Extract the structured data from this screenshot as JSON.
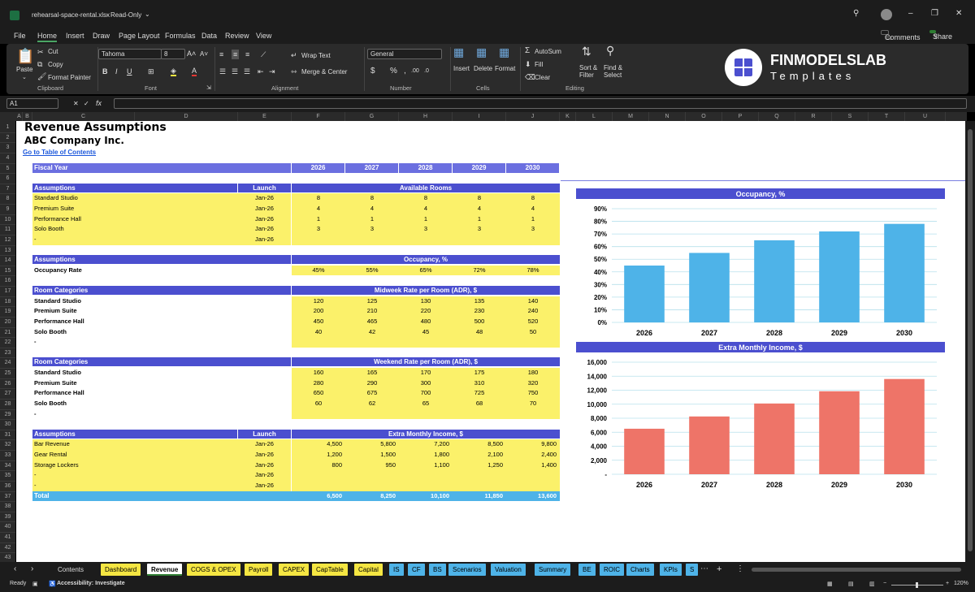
{
  "window": {
    "title": "rehearsal-space-rental.xlsx",
    "mode": "Read-Only"
  },
  "menu": [
    "File",
    "Home",
    "Insert",
    "Draw",
    "Page Layout",
    "Formulas",
    "Data",
    "Review",
    "View"
  ],
  "actions": {
    "comments": "Comments",
    "share": "Share"
  },
  "ribbon": {
    "clipboard": {
      "paste": "Paste",
      "cut": "Cut",
      "copy": "Copy",
      "format_painter": "Format Painter",
      "label": "Clipboard"
    },
    "font": {
      "name": "Tahoma",
      "size": "8",
      "label": "Font"
    },
    "alignment": {
      "wrap": "Wrap Text",
      "merge": "Merge & Center",
      "label": "Alignment"
    },
    "number": {
      "format": "General",
      "label": "Number"
    },
    "cells": {
      "insert": "Insert",
      "delete": "Delete",
      "format": "Format",
      "label": "Cells"
    },
    "editing": {
      "autosum": "AutoSum",
      "fill": "Fill",
      "clear": "Clear",
      "sort": "Sort &",
      "filter": "Filter",
      "find": "Find &",
      "select": "Select",
      "label": "Editing"
    },
    "brand": {
      "name": "FINMODELSLAB",
      "sub": "Templates"
    }
  },
  "formula_bar": {
    "cell_ref": "A1",
    "fx": "fx",
    "value": ""
  },
  "columns": [
    "A",
    "B",
    "C",
    "D",
    "E",
    "F",
    "G",
    "H",
    "I",
    "J",
    "K",
    "L",
    "M",
    "N",
    "O",
    "P",
    "Q",
    "R",
    "S",
    "T",
    "U"
  ],
  "rows": [
    "1",
    "2",
    "3",
    "4",
    "5",
    "6",
    "7",
    "8",
    "9",
    "10",
    "11",
    "12",
    "13",
    "14",
    "15",
    "16",
    "17",
    "18",
    "19",
    "20",
    "21",
    "22",
    "23",
    "24",
    "25",
    "26",
    "27",
    "28",
    "29",
    "30",
    "31",
    "32",
    "33",
    "34",
    "35",
    "36",
    "37",
    "38",
    "39",
    "40",
    "41",
    "42",
    "43"
  ],
  "sheet": {
    "title": "Revenue Assumptions",
    "company": "ABC Company Inc.",
    "toc_link": "Go to Table of Contents",
    "fiscal_year_label": "Fiscal Year",
    "years": [
      "2026",
      "2027",
      "2028",
      "2029",
      "2030"
    ],
    "rooms": {
      "header_left": "Assumptions",
      "header_launch": "Launch",
      "header_right": "Available Rooms",
      "rows": [
        {
          "name": "Standard Studio",
          "launch": "Jan-26",
          "values": [
            "8",
            "8",
            "8",
            "8",
            "8"
          ]
        },
        {
          "name": "Premium Suite",
          "launch": "Jan-26",
          "values": [
            "4",
            "4",
            "4",
            "4",
            "4"
          ]
        },
        {
          "name": "Performance Hall",
          "launch": "Jan-26",
          "values": [
            "1",
            "1",
            "1",
            "1",
            "1"
          ]
        },
        {
          "name": "Solo Booth",
          "launch": "Jan-26",
          "values": [
            "3",
            "3",
            "3",
            "3",
            "3"
          ]
        },
        {
          "name": "-",
          "launch": "Jan-26",
          "values": [
            "",
            "",
            "",
            "",
            ""
          ]
        }
      ]
    },
    "occupancy": {
      "header_left": "Assumptions",
      "header_right": "Occupancy, %",
      "row_label": "Occupancy Rate",
      "values": [
        "45%",
        "55%",
        "65%",
        "72%",
        "78%"
      ]
    },
    "midweek": {
      "header_left": "Room Categories",
      "header_right": "Midweek Rate per Room (ADR), $",
      "rows": [
        {
          "name": "Standard Studio",
          "values": [
            "120",
            "125",
            "130",
            "135",
            "140"
          ]
        },
        {
          "name": "Premium Suite",
          "values": [
            "200",
            "210",
            "220",
            "230",
            "240"
          ]
        },
        {
          "name": "Performance Hall",
          "values": [
            "450",
            "465",
            "480",
            "500",
            "520"
          ]
        },
        {
          "name": "Solo Booth",
          "values": [
            "40",
            "42",
            "45",
            "48",
            "50"
          ]
        },
        {
          "name": "-",
          "values": [
            "",
            "",
            "",
            "",
            ""
          ]
        }
      ]
    },
    "weekend": {
      "header_left": "Room Categories",
      "header_right": "Weekend Rate per Room (ADR), $",
      "rows": [
        {
          "name": "Standard Studio",
          "values": [
            "160",
            "165",
            "170",
            "175",
            "180"
          ]
        },
        {
          "name": "Premium Suite",
          "values": [
            "280",
            "290",
            "300",
            "310",
            "320"
          ]
        },
        {
          "name": "Performance Hall",
          "values": [
            "650",
            "675",
            "700",
            "725",
            "750"
          ]
        },
        {
          "name": "Solo Booth",
          "values": [
            "60",
            "62",
            "65",
            "68",
            "70"
          ]
        },
        {
          "name": "-",
          "values": [
            "",
            "",
            "",
            "",
            ""
          ]
        }
      ]
    },
    "extra": {
      "header_left": "Assumptions",
      "header_launch": "Launch",
      "header_right": "Extra Monthly Income, $",
      "rows": [
        {
          "name": "Bar Revenue",
          "launch": "Jan-26",
          "values": [
            "4,500",
            "5,800",
            "7,200",
            "8,500",
            "9,800"
          ]
        },
        {
          "name": "Gear Rental",
          "launch": "Jan-26",
          "values": [
            "1,200",
            "1,500",
            "1,800",
            "2,100",
            "2,400"
          ]
        },
        {
          "name": "Storage Lockers",
          "launch": "Jan-26",
          "values": [
            "800",
            "950",
            "1,100",
            "1,250",
            "1,400"
          ]
        },
        {
          "name": "-",
          "launch": "Jan-26",
          "values": [
            "",
            "",
            "",
            "",
            ""
          ]
        },
        {
          "name": "-",
          "launch": "Jan-26",
          "values": [
            "",
            "",
            "",
            "",
            ""
          ]
        }
      ],
      "total_label": "Total",
      "totals": [
        "6,500",
        "8,250",
        "10,100",
        "11,850",
        "13,600"
      ]
    }
  },
  "chart_data": [
    {
      "type": "bar",
      "title": "Occupancy, %",
      "categories": [
        "2026",
        "2027",
        "2028",
        "2029",
        "2030"
      ],
      "values": [
        45,
        55,
        65,
        72,
        78
      ],
      "ylim": [
        0,
        90
      ],
      "ticks": [
        "0%",
        "10%",
        "20%",
        "30%",
        "40%",
        "50%",
        "60%",
        "70%",
        "80%",
        "90%"
      ],
      "color": "#4eb3e8",
      "grid": true
    },
    {
      "type": "bar",
      "title": "Extra Monthly Income, $",
      "categories": [
        "2026",
        "2027",
        "2028",
        "2029",
        "2030"
      ],
      "values": [
        6500,
        8250,
        10100,
        11850,
        13600
      ],
      "ylim": [
        0,
        16000
      ],
      "ticks": [
        "-",
        "2,000",
        "4,000",
        "6,000",
        "8,000",
        "10,000",
        "12,000",
        "14,000",
        "16,000"
      ],
      "color": "#ee7468",
      "grid": true
    }
  ],
  "tabs": [
    {
      "label": "Contents",
      "color": "#1c1c1c",
      "text": "#ddd"
    },
    {
      "label": "Dashboard",
      "color": "#f5e642",
      "text": "#000"
    },
    {
      "label": "Revenue",
      "color": "#ffffff",
      "text": "#000",
      "active": true
    },
    {
      "label": "COGS & OPEX",
      "color": "#f5e642",
      "text": "#000"
    },
    {
      "label": "Payroll",
      "color": "#f5e642",
      "text": "#000"
    },
    {
      "label": "CAPEX",
      "color": "#f5e642",
      "text": "#000"
    },
    {
      "label": "CapTable",
      "color": "#f5e642",
      "text": "#000"
    },
    {
      "label": "Capital",
      "color": "#f5e642",
      "text": "#000"
    },
    {
      "label": "IS",
      "color": "#4eb3e8",
      "text": "#000"
    },
    {
      "label": "CF",
      "color": "#4eb3e8",
      "text": "#000"
    },
    {
      "label": "BS",
      "color": "#4eb3e8",
      "text": "#000"
    },
    {
      "label": "Scenarios",
      "color": "#4eb3e8",
      "text": "#000"
    },
    {
      "label": "Valuation",
      "color": "#4eb3e8",
      "text": "#000"
    },
    {
      "label": "Summary",
      "color": "#4eb3e8",
      "text": "#000"
    },
    {
      "label": "BE",
      "color": "#4eb3e8",
      "text": "#000"
    },
    {
      "label": "ROIC",
      "color": "#4eb3e8",
      "text": "#000"
    },
    {
      "label": "Charts",
      "color": "#4eb3e8",
      "text": "#000"
    },
    {
      "label": "KPIs",
      "color": "#4eb3e8",
      "text": "#000"
    },
    {
      "label": "S",
      "color": "#4eb3e8",
      "text": "#000"
    }
  ],
  "status": {
    "ready": "Ready",
    "accessibility": "Accessibility: Investigate",
    "zoom": "120%"
  },
  "colors": {
    "header": "#4b4fcf",
    "yellow": "#fbf16a",
    "total": "#4eb3e8"
  }
}
